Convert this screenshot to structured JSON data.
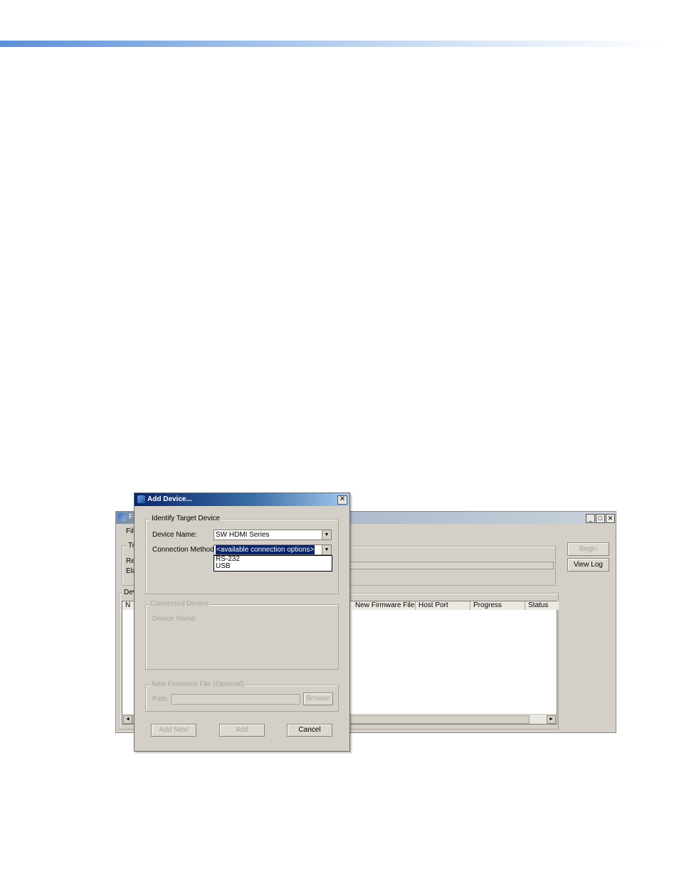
{
  "main_window": {
    "title_peek": "F",
    "menu_file": "File",
    "group_peek": "Tra",
    "row1_peek": "Re",
    "row2_peek": "Ela",
    "list_group_peek": "Dev",
    "first_col_peek": "N",
    "columns": [
      "New Firmware File",
      "Host Port",
      "Progress",
      "Status"
    ],
    "begin_label": "Begin",
    "view_log_label": "View Log",
    "minimize_glyph": "_",
    "maximize_glyph": "□",
    "close_glyph": "✕",
    "scroll_left_glyph": "◄",
    "scroll_right_glyph": "►"
  },
  "dialog": {
    "title": "Add Device...",
    "close_glyph": "✕",
    "identify_group": "Identify Target Device",
    "device_name_label": "Device Name:",
    "device_name_value": "SW HDMI Series",
    "connection_method_label": "Connection Method:",
    "connection_method_value": "<available connection options>",
    "connection_options": [
      "RS-232",
      "USB"
    ],
    "connected_group": "Connected Device",
    "connected_device_name_label": "Device Name:",
    "firmware_group": "New Firmware File (Optional)",
    "path_label": "Path:",
    "browse_label": "Browse",
    "add_next_label": "Add Next",
    "add_label": "Add",
    "cancel_label": "Cancel",
    "arrow_glyph": "▼"
  }
}
